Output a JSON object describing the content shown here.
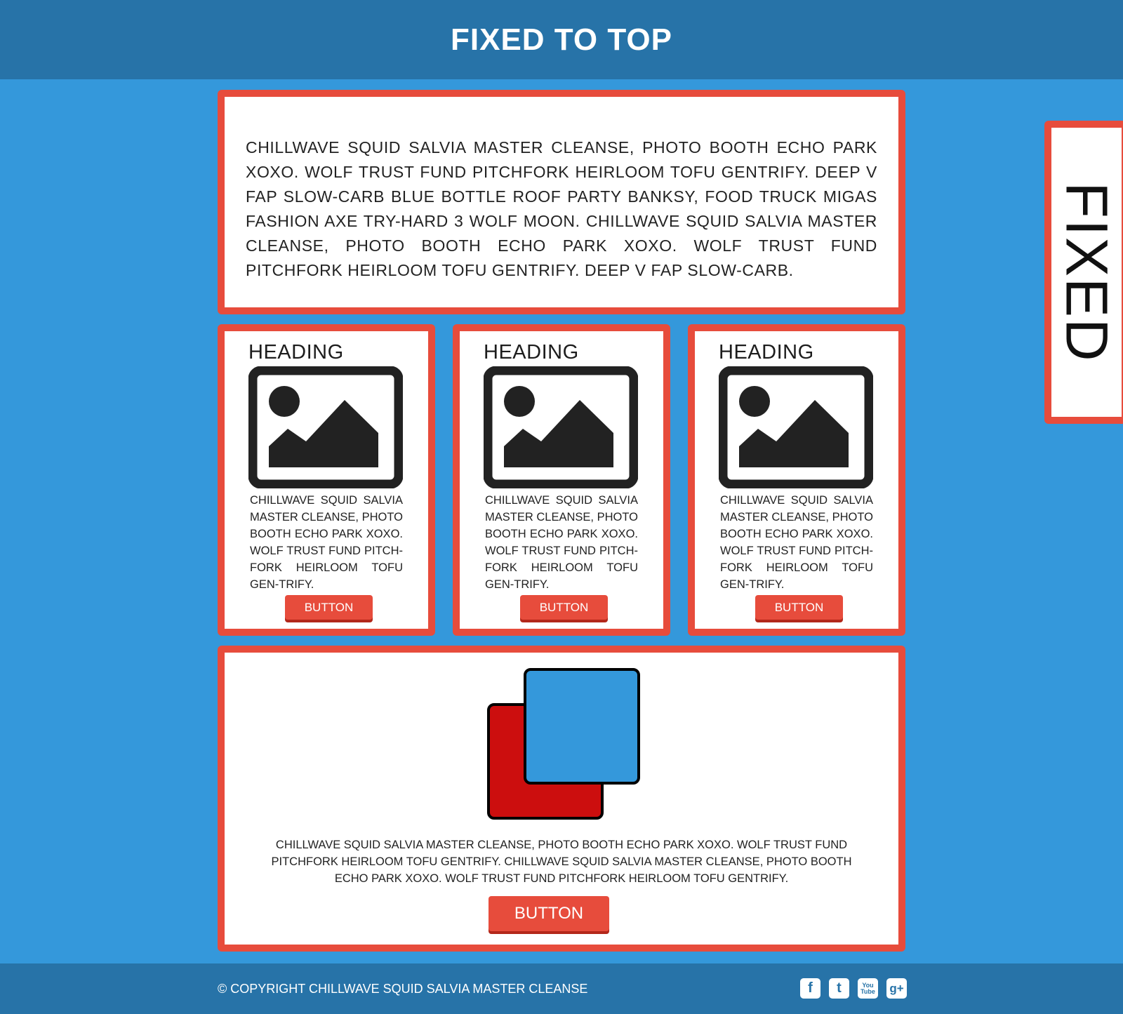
{
  "header": {
    "title": "FIXED TO TOP"
  },
  "intro": {
    "text": "Chillwave squid salvia master cleanse, photo booth echo park xoxo. Wolf trust fund pitchfork heirloom tofu gentrify. Deep v fap slow-carb blue bottle roof party Banksy, food truck migas fashion axe try-hard 3 wolf moon. Chillwave squid salvia master cleanse, photo booth echo park xoxo. Wolf trust fund pitchfork heirloom tofu gentrify. Deep v fap slow-carb."
  },
  "cards": [
    {
      "heading": "HEADING",
      "icon": "image-icon",
      "text": "Chillwave squid salvia master cleanse, photo booth echo park xoxo. Wolf trust fund pitch-fork heirloom tofu gen-trify.",
      "button": "BUTTON"
    },
    {
      "heading": "HEADING",
      "icon": "image-icon",
      "text": "Chillwave squid salvia master cleanse, photo booth echo park xoxo. Wolf trust fund pitch-fork heirloom tofu gen-trify.",
      "button": "BUTTON"
    },
    {
      "heading": "HEADING",
      "icon": "image-icon",
      "text": "Chillwave squid salvia master cleanse, photo booth echo park xoxo. Wolf trust fund pitch-fork heirloom tofu gen-trify.",
      "button": "BUTTON"
    }
  ],
  "feature": {
    "icon": "overlapping-squares-icon",
    "text": "Chillwave squid salvia master cleanse, photo booth echo park xoxo. Wolf trust fund pitchfork heirloom tofu gentrify. Chillwave squid salvia master cleanse, photo booth echo park xoxo. Wolf trust fund pitchfork heirloom tofu gentrify.",
    "button": "BUTTON"
  },
  "side_panel": {
    "label": "FIXED"
  },
  "footer": {
    "copyright": "© Copyright Chillwave Squid Salvia Master Cleanse",
    "socials": [
      {
        "icon": "facebook-icon",
        "glyph": "f"
      },
      {
        "icon": "twitter-icon",
        "glyph": "t"
      },
      {
        "icon": "youtube-icon",
        "glyph": "You Tube"
      },
      {
        "icon": "google-plus-icon",
        "glyph": "g+"
      }
    ]
  },
  "colors": {
    "background": "#3498db",
    "bar": "#2773a8",
    "accent": "#e74c3c",
    "square_red": "#cc0e0e",
    "square_blue": "#3498db"
  }
}
